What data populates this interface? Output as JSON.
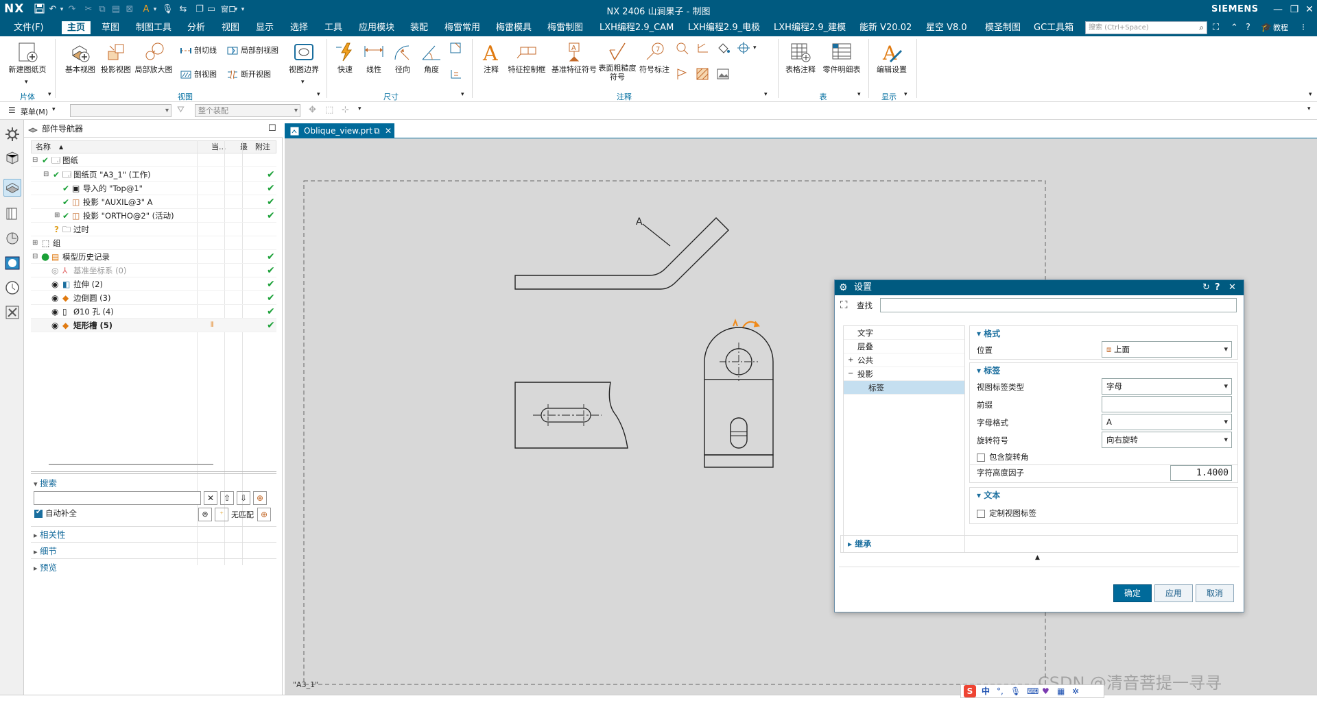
{
  "titlebar": {
    "logo": "NX",
    "title": "NX 2406 山涧果子 - 制图",
    "brand": "SIEMENS",
    "window_menu": "窗口"
  },
  "menu": {
    "file": "文件(F)",
    "items": [
      "主页",
      "草图",
      "制图工具",
      "分析",
      "视图",
      "显示",
      "选择",
      "工具",
      "应用模块",
      "装配",
      "梅雷常用",
      "梅雷模具",
      "梅雷制图",
      "LXH编程2.9_CAM",
      "LXH编程2.9_电极",
      "LXH编程2.9_建模",
      "能新 V20.02",
      "星空 V8.0",
      "模圣制图",
      "GC工具箱"
    ],
    "search_placeholder": "搜索 (Ctrl+Space)",
    "tutorial": "教程"
  },
  "ribbon": {
    "sheet": {
      "new_sheet": "新建图纸页",
      "group": "片体"
    },
    "view": {
      "base": "基本视图",
      "projected": "投影视图",
      "detail": "局部放大图",
      "section_line": "剖切线",
      "section_view": "剖视图",
      "local_section": "局部剖视图",
      "break_view": "断开视图",
      "view_border": "视图边界",
      "group": "视图"
    },
    "dimension": {
      "rapid": "快速",
      "linear": "线性",
      "radial": "径向",
      "angular": "角度",
      "group": "尺寸"
    },
    "annotation": {
      "note": "注释",
      "feature_ctrl": "特征控制框",
      "datum": "基准特征符号",
      "surface": "表面粗糙度符号",
      "symbol": "符号标注",
      "group": "注释"
    },
    "table": {
      "tabular": "表格注释",
      "parts_list": "零件明细表",
      "group": "表"
    },
    "display": {
      "edit_settings": "编辑设置",
      "group": "显示"
    }
  },
  "selbar": {
    "menu": "菜单(M)",
    "filter": "",
    "scope": "整个装配"
  },
  "navigator": {
    "title": "部件导航器",
    "col_name": "名称",
    "col_current": "当...",
    "col_latest": "最",
    "col_note": "附注",
    "rows": [
      {
        "label": "图纸"
      },
      {
        "label": "图纸页 \"A3_1\" (工作)"
      },
      {
        "label": "导入的 \"Top@1\""
      },
      {
        "label": "投影 \"AUXIL@3\" A"
      },
      {
        "label": "投影 \"ORTHO@2\" (活动)"
      },
      {
        "label": "过时"
      },
      {
        "label": "组"
      },
      {
        "label": "模型历史记录"
      },
      {
        "label": "基准坐标系 (0)"
      },
      {
        "label": "拉伸 (2)"
      },
      {
        "label": "边倒圆 (3)"
      },
      {
        "label": "Ø10 孔 (4)"
      },
      {
        "label": "矩形槽 (5)"
      }
    ],
    "search_section": "搜索",
    "auto_complete": "自动补全",
    "no_match": "无匹配",
    "sections": [
      "相关性",
      "细节",
      "预览"
    ]
  },
  "document": {
    "tab": "Oblique_view.prt",
    "sheet_label": "\"A3_1\"",
    "view_label": "A"
  },
  "dialog": {
    "title": "设置",
    "find_label": "查找",
    "find_value": "",
    "tree": [
      "文字",
      "层叠",
      "公共",
      "投影",
      "标签"
    ],
    "format_section": "格式",
    "position_label": "位置",
    "position_value": "上面",
    "label_section": "标签",
    "label_type_label": "视图标签类型",
    "label_type_value": "字母",
    "prefix_label": "前缀",
    "prefix_value": "",
    "letter_format_label": "字母格式",
    "letter_format_value": "A",
    "rotation_label": "旋转符号",
    "rotation_value": "向右旋转",
    "include_angle": "包含旋转角",
    "height_factor_label": "字符高度因子",
    "height_factor_value": "1.4000",
    "text_section": "文本",
    "custom_label": "定制视图标签",
    "inherit_section": "继承",
    "ok": "确定",
    "apply": "应用",
    "cancel": "取消"
  },
  "watermark": "CSDN @清音菩提一寻寻",
  "ime": "中"
}
